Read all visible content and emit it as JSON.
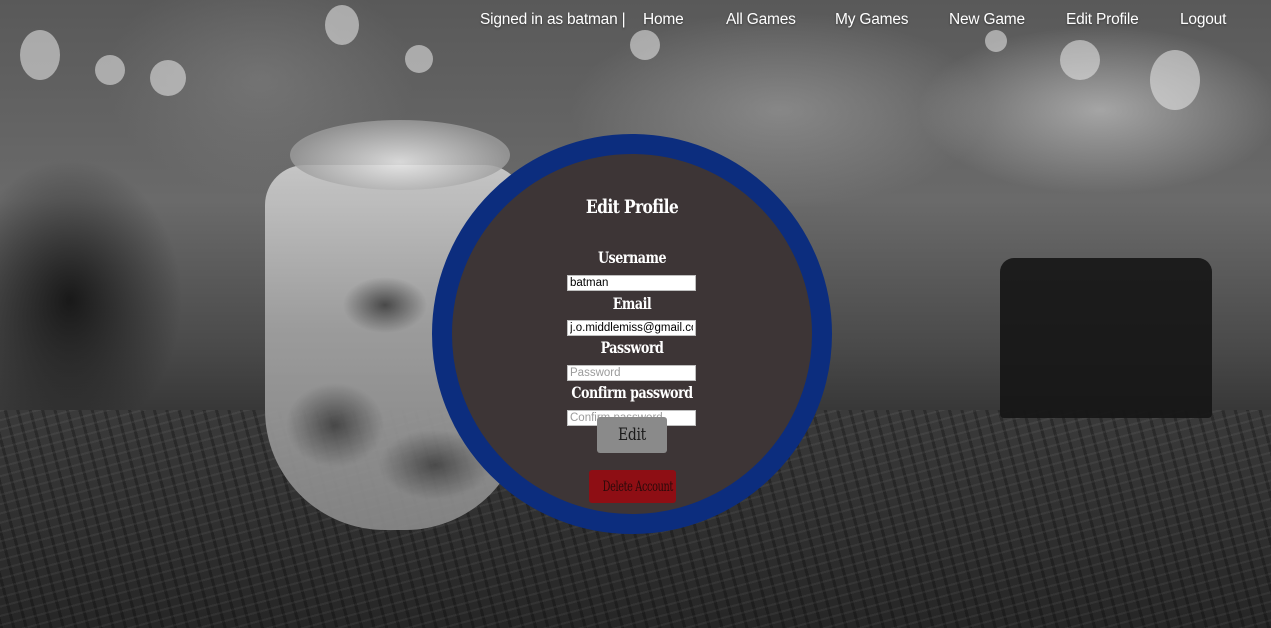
{
  "nav": {
    "signed_in": "Signed in as batman |",
    "home": "Home",
    "all_games": "All Games",
    "my_games": "My Games",
    "new_game": "New Game",
    "edit_profile": "Edit Profile",
    "logout": "Logout"
  },
  "form": {
    "title": "Edit Profile",
    "username_label": "Username",
    "username_value": "batman",
    "email_label": "Email",
    "email_value": "j.o.middlemiss@gmail.com",
    "password_label": "Password",
    "password_placeholder": "Password",
    "confirm_label": "Confirm password",
    "confirm_placeholder": "Confirm password",
    "edit_button": "Edit",
    "delete_button": "Delete Account"
  },
  "colors": {
    "ring": "#0c2d7e",
    "card": "#3d3536",
    "edit_button": "#8a8a8a",
    "delete_button": "#8e0e14"
  }
}
